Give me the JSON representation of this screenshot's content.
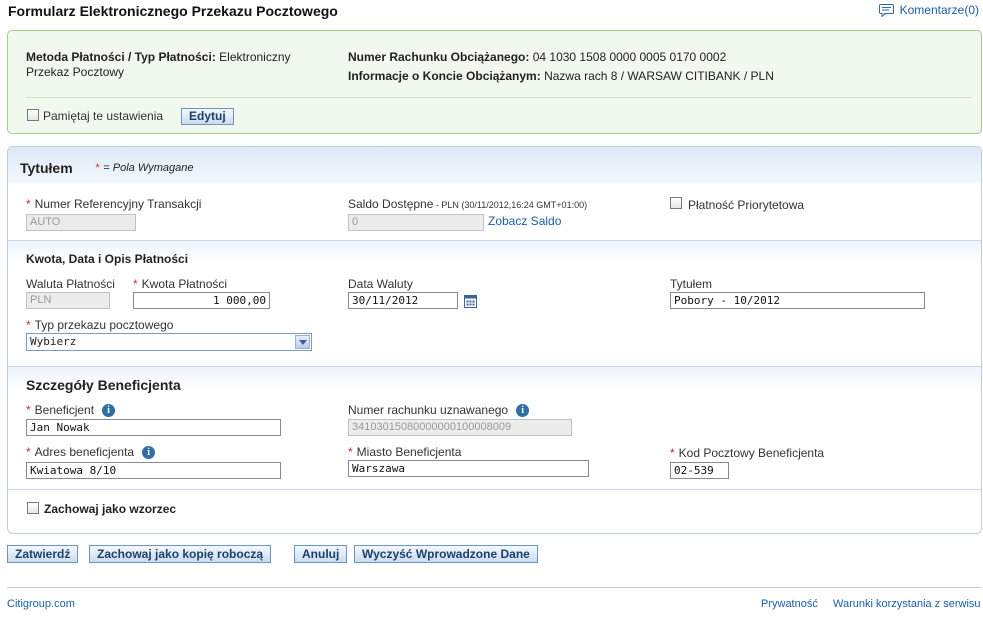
{
  "page": {
    "title": "Formularz Elektronicznego Przekazu Pocztowego",
    "comments_link": "Komentarze(0)"
  },
  "summary": {
    "method_label": "Metoda Płatności / Typ Płatności:",
    "method_value_1": "Elektroniczny",
    "method_value_2": "Przekaz Pocztowy",
    "account_label": "Numer Rachunku Obciążanego:",
    "account_value": "04 1030 1508 0000 0005 0170 0002",
    "account_info_label": "Informacje o Koncie Obciążanym:",
    "account_info_value": "Nazwa rach 8 / WARSAW CITIBANK / PLN",
    "remember_label": "Pamiętaj te ustawienia",
    "remember_checked": false,
    "edit_button": "Edytuj"
  },
  "header": {
    "section_title": "Tytułem",
    "required_mark": "*",
    "required_note": "= Pola Wymagane"
  },
  "transaction": {
    "ref_label": "Numer Referencyjny Transakcji",
    "ref_value": "AUTO",
    "balance_label": "Saldo Dostępne",
    "balance_note": " - PLN (30/11/2012,16:24 GMT+01:00)",
    "balance_value": "0",
    "balance_link": "Zobacz Saldo",
    "priority_label": "Płatność Priorytetowa",
    "priority_checked": false
  },
  "payment": {
    "section_title": "Kwota, Data i Opis Płatności",
    "currency_label": "Waluta Płatności",
    "currency_value": "PLN",
    "amount_label": "Kwota Płatności",
    "amount_value": "1 000,00",
    "date_label": "Data Waluty",
    "date_value": "30/11/2012",
    "title_label": "Tytułem",
    "title_value": "Pobory - 10/2012",
    "type_label": "Typ przekazu pocztowego",
    "type_value": "Wybierz"
  },
  "beneficiary": {
    "section_title": "Szczegóły Beneficjenta",
    "name_label": "Beneficjent",
    "name_value": "Jan Nowak",
    "account_label": "Numer rachunku uznawanego",
    "account_value": "34103015080000000100008009",
    "address_label": "Adres beneficjenta",
    "address_value": "Kwiatowa 8/10",
    "city_label": "Miasto Beneficjenta",
    "city_value": "Warszawa",
    "postal_label": "Kod Pocztowy Beneficjenta",
    "postal_value": "02-539",
    "info_glyph": "i"
  },
  "template": {
    "save_as_template_label": "Zachowaj jako wzorzec",
    "checked": false
  },
  "actions": {
    "submit": "Zatwierdź",
    "save_draft": "Zachowaj jako kopię roboczą",
    "cancel": "Anuluj",
    "clear": "Wyczyść Wprowadzone Dane"
  },
  "footer": {
    "brand": "Citigroup.com",
    "privacy": "Prywatność",
    "terms": "Warunki korzystania z serwisu"
  },
  "colors": {
    "link": "#1a5ea8",
    "required": "#cc2a2a",
    "summary_bg": "#f1f8ee",
    "summary_border": "#9fd089",
    "form_border": "#b9cde3"
  },
  "icons": {
    "comments": "speech-bubble-icon",
    "calendar": "calendar-icon",
    "info": "info-icon",
    "dropdown": "chevron-down-icon"
  }
}
